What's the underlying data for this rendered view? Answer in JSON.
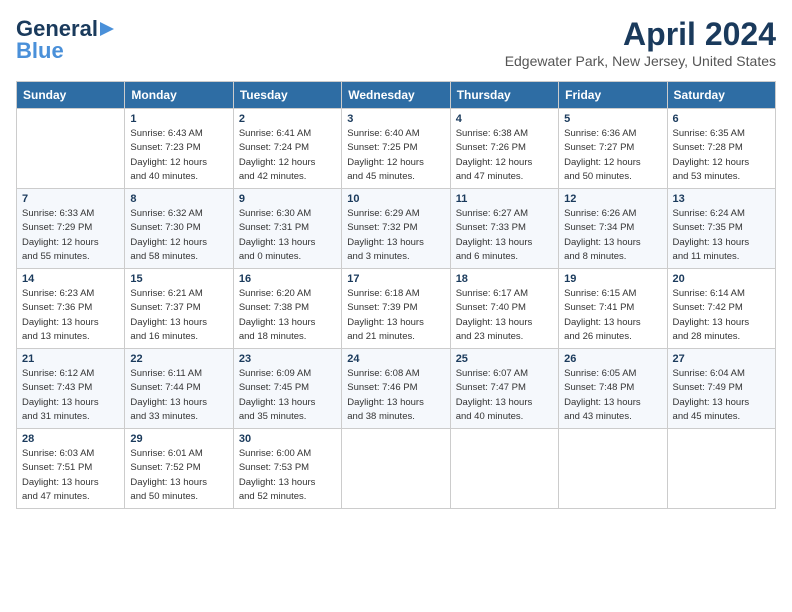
{
  "header": {
    "logo_line1": "General",
    "logo_line2": "Blue",
    "title": "April 2024",
    "subtitle": "Edgewater Park, New Jersey, United States"
  },
  "columns": [
    "Sunday",
    "Monday",
    "Tuesday",
    "Wednesday",
    "Thursday",
    "Friday",
    "Saturday"
  ],
  "weeks": [
    [
      {
        "day": "",
        "info": ""
      },
      {
        "day": "1",
        "info": "Sunrise: 6:43 AM\nSunset: 7:23 PM\nDaylight: 12 hours\nand 40 minutes."
      },
      {
        "day": "2",
        "info": "Sunrise: 6:41 AM\nSunset: 7:24 PM\nDaylight: 12 hours\nand 42 minutes."
      },
      {
        "day": "3",
        "info": "Sunrise: 6:40 AM\nSunset: 7:25 PM\nDaylight: 12 hours\nand 45 minutes."
      },
      {
        "day": "4",
        "info": "Sunrise: 6:38 AM\nSunset: 7:26 PM\nDaylight: 12 hours\nand 47 minutes."
      },
      {
        "day": "5",
        "info": "Sunrise: 6:36 AM\nSunset: 7:27 PM\nDaylight: 12 hours\nand 50 minutes."
      },
      {
        "day": "6",
        "info": "Sunrise: 6:35 AM\nSunset: 7:28 PM\nDaylight: 12 hours\nand 53 minutes."
      }
    ],
    [
      {
        "day": "7",
        "info": "Sunrise: 6:33 AM\nSunset: 7:29 PM\nDaylight: 12 hours\nand 55 minutes."
      },
      {
        "day": "8",
        "info": "Sunrise: 6:32 AM\nSunset: 7:30 PM\nDaylight: 12 hours\nand 58 minutes."
      },
      {
        "day": "9",
        "info": "Sunrise: 6:30 AM\nSunset: 7:31 PM\nDaylight: 13 hours\nand 0 minutes."
      },
      {
        "day": "10",
        "info": "Sunrise: 6:29 AM\nSunset: 7:32 PM\nDaylight: 13 hours\nand 3 minutes."
      },
      {
        "day": "11",
        "info": "Sunrise: 6:27 AM\nSunset: 7:33 PM\nDaylight: 13 hours\nand 6 minutes."
      },
      {
        "day": "12",
        "info": "Sunrise: 6:26 AM\nSunset: 7:34 PM\nDaylight: 13 hours\nand 8 minutes."
      },
      {
        "day": "13",
        "info": "Sunrise: 6:24 AM\nSunset: 7:35 PM\nDaylight: 13 hours\nand 11 minutes."
      }
    ],
    [
      {
        "day": "14",
        "info": "Sunrise: 6:23 AM\nSunset: 7:36 PM\nDaylight: 13 hours\nand 13 minutes."
      },
      {
        "day": "15",
        "info": "Sunrise: 6:21 AM\nSunset: 7:37 PM\nDaylight: 13 hours\nand 16 minutes."
      },
      {
        "day": "16",
        "info": "Sunrise: 6:20 AM\nSunset: 7:38 PM\nDaylight: 13 hours\nand 18 minutes."
      },
      {
        "day": "17",
        "info": "Sunrise: 6:18 AM\nSunset: 7:39 PM\nDaylight: 13 hours\nand 21 minutes."
      },
      {
        "day": "18",
        "info": "Sunrise: 6:17 AM\nSunset: 7:40 PM\nDaylight: 13 hours\nand 23 minutes."
      },
      {
        "day": "19",
        "info": "Sunrise: 6:15 AM\nSunset: 7:41 PM\nDaylight: 13 hours\nand 26 minutes."
      },
      {
        "day": "20",
        "info": "Sunrise: 6:14 AM\nSunset: 7:42 PM\nDaylight: 13 hours\nand 28 minutes."
      }
    ],
    [
      {
        "day": "21",
        "info": "Sunrise: 6:12 AM\nSunset: 7:43 PM\nDaylight: 13 hours\nand 31 minutes."
      },
      {
        "day": "22",
        "info": "Sunrise: 6:11 AM\nSunset: 7:44 PM\nDaylight: 13 hours\nand 33 minutes."
      },
      {
        "day": "23",
        "info": "Sunrise: 6:09 AM\nSunset: 7:45 PM\nDaylight: 13 hours\nand 35 minutes."
      },
      {
        "day": "24",
        "info": "Sunrise: 6:08 AM\nSunset: 7:46 PM\nDaylight: 13 hours\nand 38 minutes."
      },
      {
        "day": "25",
        "info": "Sunrise: 6:07 AM\nSunset: 7:47 PM\nDaylight: 13 hours\nand 40 minutes."
      },
      {
        "day": "26",
        "info": "Sunrise: 6:05 AM\nSunset: 7:48 PM\nDaylight: 13 hours\nand 43 minutes."
      },
      {
        "day": "27",
        "info": "Sunrise: 6:04 AM\nSunset: 7:49 PM\nDaylight: 13 hours\nand 45 minutes."
      }
    ],
    [
      {
        "day": "28",
        "info": "Sunrise: 6:03 AM\nSunset: 7:51 PM\nDaylight: 13 hours\nand 47 minutes."
      },
      {
        "day": "29",
        "info": "Sunrise: 6:01 AM\nSunset: 7:52 PM\nDaylight: 13 hours\nand 50 minutes."
      },
      {
        "day": "30",
        "info": "Sunrise: 6:00 AM\nSunset: 7:53 PM\nDaylight: 13 hours\nand 52 minutes."
      },
      {
        "day": "",
        "info": ""
      },
      {
        "day": "",
        "info": ""
      },
      {
        "day": "",
        "info": ""
      },
      {
        "day": "",
        "info": ""
      }
    ]
  ]
}
